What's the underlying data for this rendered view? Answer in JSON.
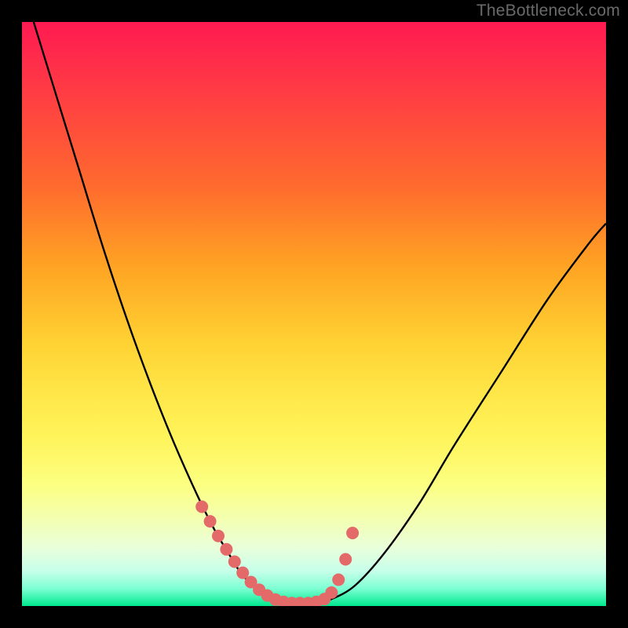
{
  "watermark": "TheBottleneck.com",
  "colors": {
    "background": "#000000",
    "curve_stroke": "#000000",
    "marker_fill": "#e46a6a",
    "marker_stroke": "#c24d4d"
  },
  "chart_data": {
    "type": "line",
    "title": "",
    "xlabel": "",
    "ylabel": "",
    "xlim": [
      0,
      1
    ],
    "ylim": [
      0,
      1
    ],
    "series": [
      {
        "name": "bottleneck-curve",
        "x": [
          0.02,
          0.06,
          0.1,
          0.14,
          0.18,
          0.22,
          0.26,
          0.3,
          0.33,
          0.36,
          0.38,
          0.41,
          0.44,
          0.47,
          0.5,
          0.53,
          0.57,
          0.62,
          0.68,
          0.74,
          0.82,
          0.9,
          0.97,
          1.0
        ],
        "y": [
          1.0,
          0.87,
          0.74,
          0.61,
          0.49,
          0.38,
          0.28,
          0.19,
          0.13,
          0.08,
          0.05,
          0.028,
          0.013,
          0.005,
          0.005,
          0.012,
          0.035,
          0.09,
          0.175,
          0.275,
          0.4,
          0.525,
          0.62,
          0.655
        ]
      },
      {
        "name": "bottom-markers",
        "x": [
          0.308,
          0.322,
          0.336,
          0.35,
          0.364,
          0.378,
          0.392,
          0.406,
          0.42,
          0.434,
          0.448,
          0.462,
          0.476,
          0.49,
          0.504,
          0.518,
          0.53,
          0.542,
          0.554,
          0.566
        ],
        "y": [
          0.17,
          0.145,
          0.12,
          0.097,
          0.076,
          0.057,
          0.041,
          0.028,
          0.018,
          0.011,
          0.007,
          0.005,
          0.005,
          0.005,
          0.007,
          0.012,
          0.023,
          0.045,
          0.08,
          0.125
        ]
      }
    ]
  }
}
